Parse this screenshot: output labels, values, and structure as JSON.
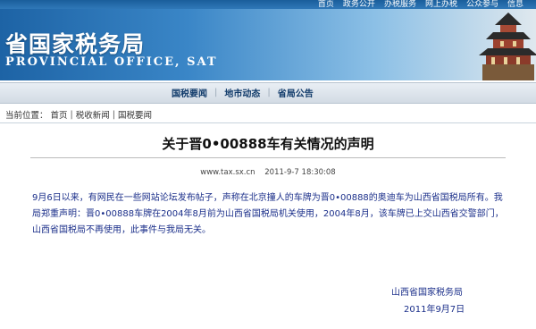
{
  "header": {
    "top_links": [
      "首页",
      "政务公开",
      "办税服务",
      "网上办税",
      "公众参与",
      "信息"
    ],
    "title": "省国家税务局",
    "subtitle": "PROVINCIAL OFFICE, SAT"
  },
  "nav": {
    "items": [
      "国税要闻",
      "地市动态",
      "省局公告"
    ]
  },
  "breadcrumb": {
    "label": "当前位置：",
    "items": [
      "首页",
      "税收新闻",
      "国税要闻"
    ],
    "separator": "|"
  },
  "article": {
    "title": "关于晋0•00888车有关情况的声明",
    "source": "www.tax.sx.cn",
    "datetime": "2011-9-7 18:30:08",
    "body": "9月6日以来，有网民在一些网站论坛发布帖子，声称在北京撞人的车牌为晋0•00888的奥迪车为山西省国税局所有。我局郑重声明：晋0•00888车牌在2004年8月前为山西省国税局机关使用，2004年8月，该车牌已上交山西省交警部门，山西省国税局不再使用，此事件与我局无关。",
    "signer": "山西省国家税务局",
    "sign_date": "2011年9月7日"
  },
  "colors": {
    "banner_dark": "#1d63a5",
    "nav_text": "#123c6b",
    "body_text": "#1b2f8a"
  }
}
